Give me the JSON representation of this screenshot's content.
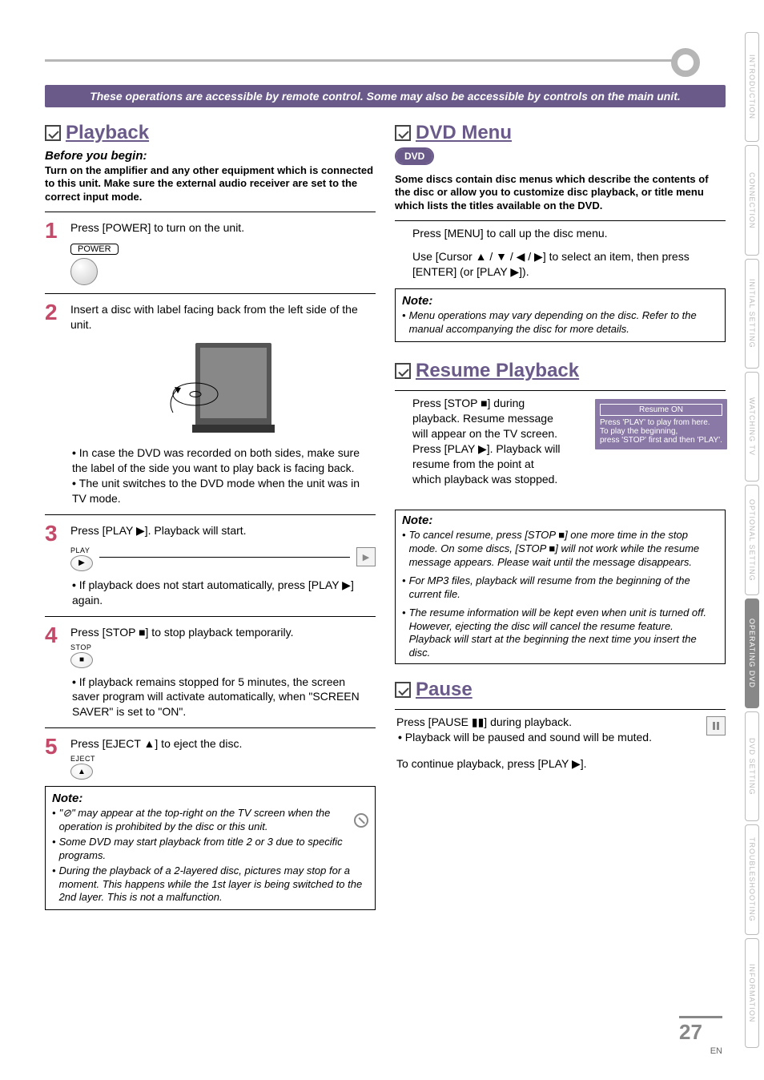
{
  "banner": "These operations are accessible by remote control.  Some may also be accessible by controls on the main unit.",
  "left": {
    "title": "Playback",
    "before_label": "Before you begin:",
    "before_text": "Turn on the amplifier and any other equipment which is connected to this unit. Make sure the external audio receiver are set to the correct input mode.",
    "step1": {
      "text": "Press [POWER] to turn on the unit.",
      "btn_label": "POWER"
    },
    "step2": {
      "text": "Insert a disc with label facing back from the left side of the unit.",
      "bullet1": "In case the DVD was recorded on both sides, make sure the label of the side you want to play back is facing back.",
      "bullet2": "The unit switches to the DVD mode when the unit was in TV mode."
    },
    "step3": {
      "text": "Press [PLAY ▶]. Playback will start.",
      "btn_label": "PLAY",
      "bullet1": "If playback does not start automatically, press [PLAY ▶] again."
    },
    "step4": {
      "text": "Press [STOP ■] to stop playback temporarily.",
      "btn_label": "STOP",
      "bullet1": "If playback remains stopped for 5 minutes, the screen saver program will activate automatically, when \"SCREEN SAVER\" is set to \"ON\"."
    },
    "step5": {
      "text": "Press [EJECT ▲] to eject the disc.",
      "btn_label": "EJECT"
    },
    "note": {
      "title": "Note:",
      "n1": "\"⊘\" may appear at the top-right on the TV screen when the operation is prohibited by the disc or this unit.",
      "n2": "Some DVD may start playback from title 2 or 3 due to specific programs.",
      "n3": "During the playback of a 2-layered disc, pictures may stop for a moment. This happens while the 1st layer is being switched to the 2nd layer. This is not a malfunction."
    }
  },
  "right": {
    "dvdmenu": {
      "title": "DVD Menu",
      "pill": "DVD",
      "intro": "Some discs contain disc menus which describe the contents of the disc or allow you to customize disc playback, or title menu which lists the titles available on the DVD.",
      "p1": "Press [MENU] to call up the disc menu.",
      "p2": "Use [Cursor ▲ / ▼ / ◀ / ▶] to select an item, then press [ENTER] (or [PLAY ▶]).",
      "note_title": "Note:",
      "note1": "Menu operations may vary depending on the disc. Refer to the manual accompanying the disc for more details."
    },
    "resume": {
      "title": "Resume Playback",
      "p1": "Press [STOP ■] during playback. Resume message will appear on the TV screen.",
      "p2": "Press [PLAY ▶]. Playback will resume from the point at which playback was stopped.",
      "osd_title": "Resume ON",
      "osd_l1": "Press 'PLAY' to play from here.",
      "osd_l2": "To play the beginning,",
      "osd_l3": "press 'STOP' first and then 'PLAY'.",
      "note_title": "Note:",
      "n1": "To cancel resume, press [STOP ■] one more time in the stop mode. On some discs, [STOP ■] will not work while the resume message appears. Please wait until the message disappears.",
      "n2": "For MP3 files, playback will resume from the beginning of the current file.",
      "n3": "The resume information will be kept even when unit is turned off. However, ejecting the disc will cancel the resume feature. Playback will start at the beginning the next time you insert the disc."
    },
    "pause": {
      "title": "Pause",
      "p1": "Press [PAUSE ▮▮] during playback.",
      "bullet": "Playback will be paused and sound will be muted.",
      "p2": "To continue playback, press [PLAY ▶]."
    }
  },
  "sidebar": {
    "tabs": [
      "INTRODUCTION",
      "CONNECTION",
      "INITIAL SETTING",
      "WATCHING TV",
      "OPTIONAL SETTING",
      "OPERATING DVD",
      "DVD SETTING",
      "TROUBLESHOOTING",
      "INFORMATION"
    ],
    "active_index": 5
  },
  "footer": {
    "page": "27",
    "lang": "EN"
  }
}
